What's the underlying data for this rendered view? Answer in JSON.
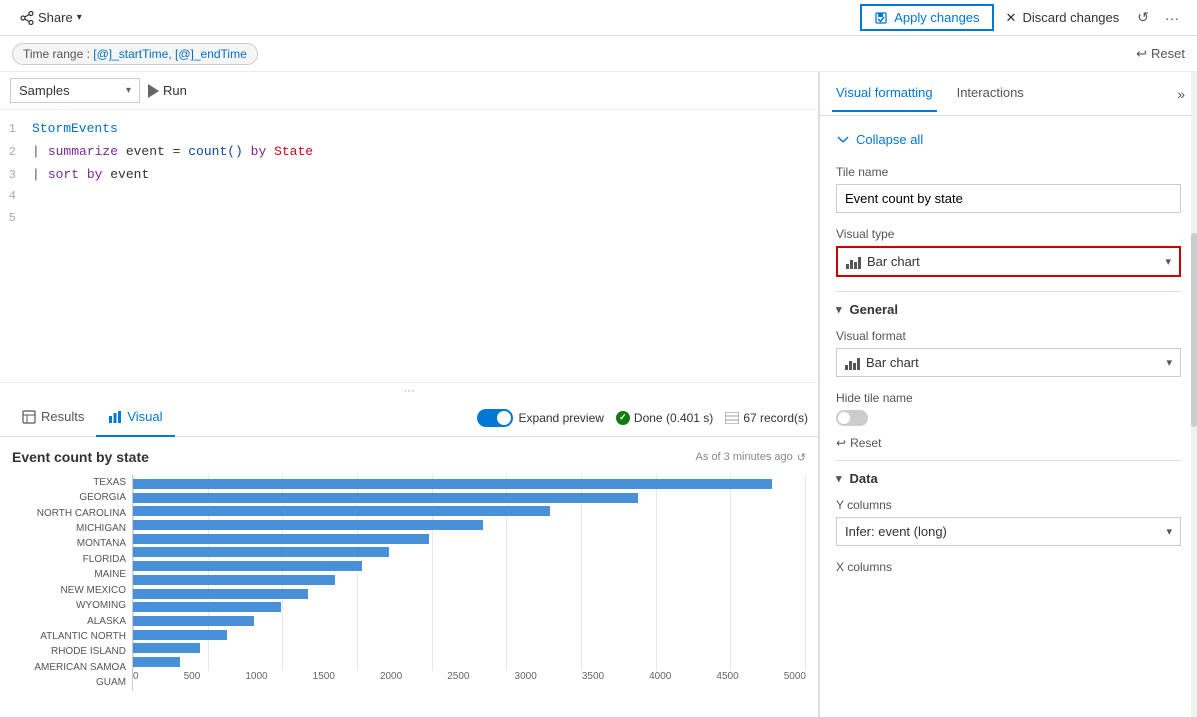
{
  "topbar": {
    "share_label": "Share",
    "apply_label": "Apply changes",
    "discard_label": "Discard changes"
  },
  "timerange": {
    "label": "Time range :",
    "value": "[@]_startTime, [@]_endTime",
    "reset_label": "Reset"
  },
  "query_toolbar": {
    "db_value": "Samples",
    "run_label": "Run"
  },
  "code_lines": [
    {
      "num": "1",
      "content": "StormEvents"
    },
    {
      "num": "2",
      "content": "| summarize event = count() by State"
    },
    {
      "num": "3",
      "content": "| sort by event"
    },
    {
      "num": "4",
      "content": ""
    },
    {
      "num": "5",
      "content": ""
    }
  ],
  "tabs": {
    "results_label": "Results",
    "visual_label": "Visual",
    "expand_label": "Expand preview",
    "done_label": "Done (0.401 s)",
    "records_label": "67 record(s)"
  },
  "chart": {
    "title": "Event count by state",
    "timestamp": "As of 3 minutes ago",
    "y_labels": [
      "TEXAS",
      "GEORGIA",
      "NORTH CAROLINA",
      "MICHIGAN",
      "MONTANA",
      "FLORIDA",
      "MAINE",
      "NEW MEXICO",
      "WYOMING",
      "ALASKA",
      "ATLANTIC NORTH",
      "RHODE ISLAND",
      "AMERICAN SAMOA",
      "GUAM"
    ],
    "x_labels": [
      "0",
      "500",
      "1000",
      "1500",
      "2000",
      "2500",
      "3000",
      "3500",
      "4000",
      "4500",
      "5000"
    ],
    "bar_widths_pct": [
      95,
      75,
      62,
      52,
      44,
      38,
      34,
      30,
      26,
      22,
      18,
      14,
      10,
      7
    ]
  },
  "right_panel": {
    "tab_formatting": "Visual formatting",
    "tab_interactions": "Interactions",
    "collapse_all": "Collapse all",
    "tile_name_label": "Tile name",
    "tile_name_value": "Event count by state",
    "visual_type_label": "Visual type",
    "visual_type_value": "Bar chart",
    "general_label": "General",
    "visual_format_label": "Visual format",
    "visual_format_value": "Bar chart",
    "hide_tile_name_label": "Hide tile name",
    "reset_label": "Reset",
    "data_label": "Data",
    "y_columns_label": "Y columns",
    "y_columns_value": "Infer: event (long)",
    "x_columns_label": "X columns"
  }
}
